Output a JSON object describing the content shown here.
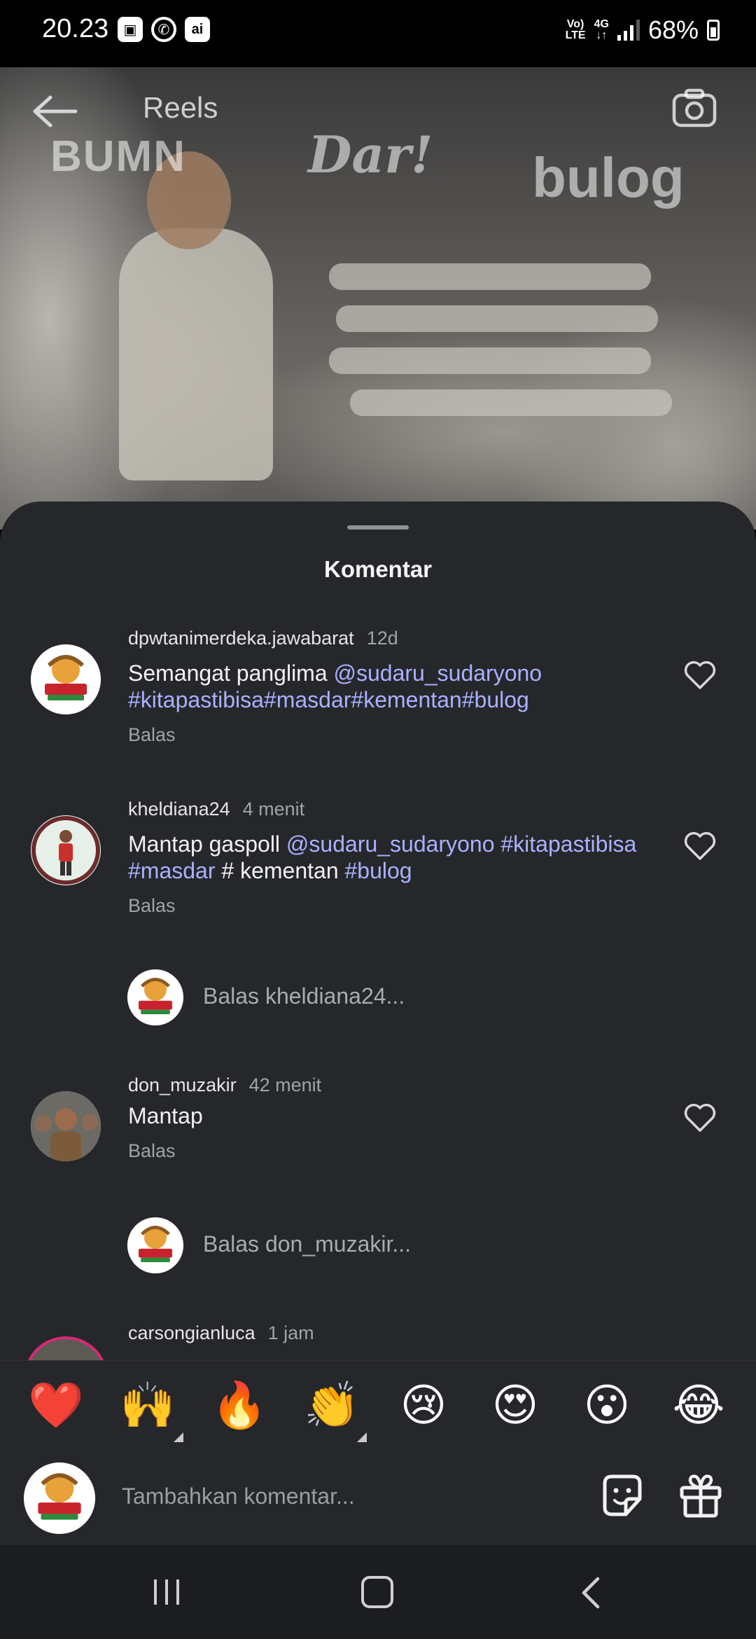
{
  "status_bar": {
    "time": "20.23",
    "network_top": "Vo)",
    "network_bottom": "LTE",
    "network_4g": "4G",
    "battery": "68%"
  },
  "video": {
    "title": "Reels",
    "watermarks": [
      "BUMN",
      "Dar!",
      "bulog"
    ]
  },
  "sheet": {
    "title": "Komentar"
  },
  "comments": [
    {
      "username": "dpwtanimerdeka.jawabarat",
      "time": "12d",
      "text_plain": "Semangat panglima ",
      "mention": "@sudaru_sudaryono",
      "tags": "#kitapastibisa#masdar#kementan#bulog",
      "reply_label": "Balas"
    },
    {
      "username": "kheldiana24",
      "time": "4 menit",
      "text_plain": "Mantap gaspoll ",
      "mention": "@sudaru_sudaryono",
      "tag1": "#kitapastibisa",
      "tag2": "#masdar",
      "middle": " # kementan ",
      "tag3": "#bulog",
      "reply_label": "Balas"
    },
    {
      "username": "don_muzakir",
      "time": "42 menit",
      "text": "Mantap",
      "reply_label": "Balas"
    },
    {
      "username": "carsongianluca",
      "time": "1 jam"
    }
  ],
  "reply_prompts": [
    "Balas kheldiana24...",
    "Balas don_muzakir..."
  ],
  "emoji_bar": [
    "❤️",
    "🙌",
    "🔥",
    "👏",
    "😢",
    "😍",
    "😮",
    "😂"
  ],
  "input": {
    "placeholder": "Tambahkan komentar..."
  },
  "avatar_text": {
    "line1": "TANI MERDEKA",
    "line2": "INDONESIA"
  },
  "colors": {
    "sheet_bg": "#25272b",
    "tag_color": "#aab1ff",
    "muted": "#a0a3a8"
  }
}
